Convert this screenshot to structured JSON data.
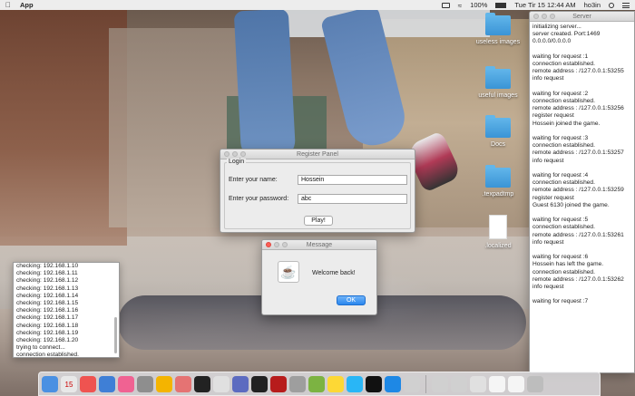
{
  "menubar": {
    "apple": "",
    "app_name": "App",
    "datetime": "Tue Tir 15  12:44 AM",
    "user": "ho3in",
    "battery": "100%"
  },
  "desktop_icons": [
    {
      "label": "useless images",
      "kind": "folder"
    },
    {
      "label": "useful images",
      "kind": "folder"
    },
    {
      "label": "Docs",
      "kind": "folder"
    },
    {
      "label": ".texpadtmp",
      "kind": "folder"
    },
    {
      "label": ".localized",
      "kind": "file"
    }
  ],
  "register": {
    "title": "Register Panel",
    "legend": "Login",
    "name_label": "Enter your name:",
    "name_value": "Hossein",
    "password_label": "Enter your password:",
    "password_value": "abc",
    "play_label": "Play!"
  },
  "message": {
    "title": "Message",
    "text": "Welcome back!",
    "ok_label": "OK"
  },
  "server": {
    "title": "Server",
    "lines": [
      "initializing server...",
      "server created. Port:1469",
      "0.0.0.0/0.0.0.0",
      "",
      "waiting for request :1",
      "connection established.",
      "remote address : /127.0.0.1:53255",
      "info request",
      "",
      "waiting for request :2",
      "connection established.",
      "remote address : /127.0.0.1:53256",
      "register request",
      "Hossein joined the game.",
      "",
      "waiting for request :3",
      "connection established.",
      "remote address : /127.0.0.1:53257",
      "info request",
      "",
      "waiting for request :4",
      "connection established.",
      "remote address : /127.0.0.1:53259",
      "register request",
      "Guest 6130 joined the game.",
      "",
      "waiting for request :5",
      "connection established.",
      "remote address : /127.0.0.1:53261",
      "info request",
      "",
      "waiting for request :6",
      "Hossein has left the game.",
      "connection established.",
      "remote address : /127.0.0.1:53262",
      "info request",
      "",
      "waiting for request :7"
    ]
  },
  "client": {
    "lines": [
      "checking: 192.168.1.10",
      "checking: 192.168.1.11",
      "checking: 192.168.1.12",
      "checking: 192.168.1.13",
      "checking: 192.168.1.14",
      "checking: 192.168.1.15",
      "checking: 192.168.1.16",
      "checking: 192.168.1.17",
      "checking: 192.168.1.18",
      "checking: 192.168.1.19",
      "checking: 192.168.1.20",
      "trying to connect...",
      "connection established."
    ]
  },
  "dock": {
    "calendar_day": "15",
    "colors": [
      "#4a90e2",
      "#e8e8e8",
      "#ef5350",
      "#3f7fd6",
      "#f06292",
      "#8e8e8e",
      "#f4b400",
      "#e57373",
      "#222",
      "#e0e0e0",
      "#5c6bc0",
      "#212121",
      "#b71c1c",
      "#9e9e9e",
      "#7cb342",
      "#fdd835",
      "#29b6f6",
      "#111",
      "#1e88e5",
      "#d0d0d0",
      "#d0d0d0",
      "#d0d0d0",
      "#e0e0e0",
      "#f5f5f5",
      "#f5f5f5",
      "#bdbdbd"
    ]
  }
}
